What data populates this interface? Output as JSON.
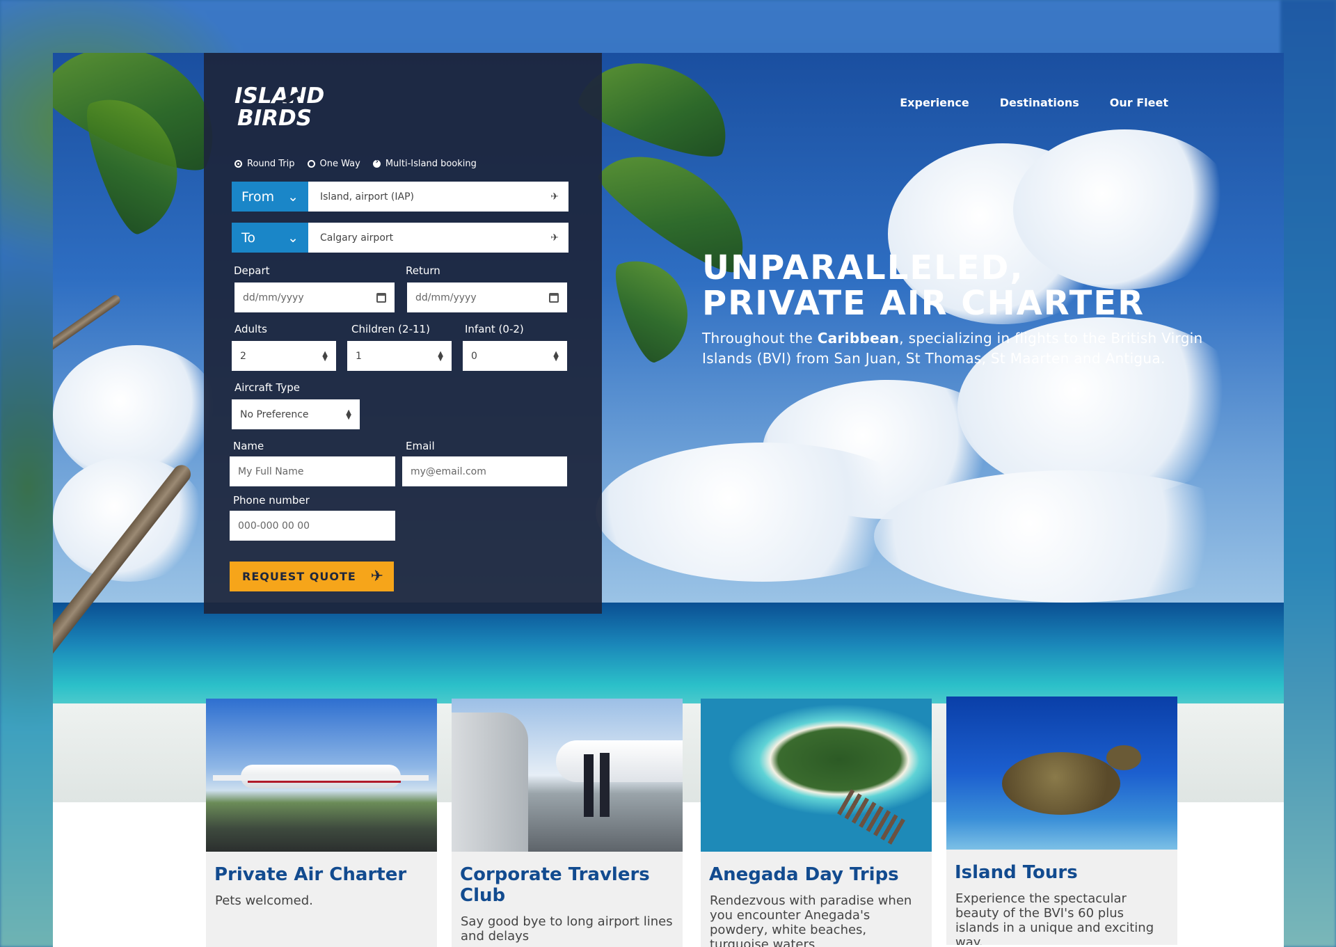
{
  "brand": {
    "logo_line1": "ISLAND",
    "logo_line2": "BIRDS"
  },
  "nav": {
    "items": [
      "Experience",
      "Destinations",
      "Our Fleet"
    ]
  },
  "hero": {
    "title_line1": "UNPARALLELED,",
    "title_line2": "PRIVATE AIR CHARTER",
    "subtitle_pre": "Throughout the ",
    "subtitle_bold": "Caribbean",
    "subtitle_post": ", specializing in flights to the British Virgin Islands (BVI) from San Juan, St Thomas, St Maarten and Antigua."
  },
  "booking": {
    "trip_types": [
      "Round Trip",
      "One Way",
      "Multi-Island booking"
    ],
    "from": {
      "label": "From",
      "value": "Island, airport (IAP)"
    },
    "to": {
      "label": "To",
      "value": "Calgary airport"
    },
    "depart": {
      "label": "Depart",
      "placeholder": "dd/mm/yyyy"
    },
    "return": {
      "label": "Return",
      "placeholder": "dd/mm/yyyy"
    },
    "adults": {
      "label": "Adults",
      "value": "2"
    },
    "children": {
      "label": "Children (2-11)",
      "value": "1"
    },
    "infant": {
      "label": "Infant (0-2)",
      "value": "0"
    },
    "aircraft": {
      "label": "Aircraft Type",
      "value": "No Preference"
    },
    "name": {
      "label": "Name",
      "placeholder": "My Full Name"
    },
    "email": {
      "label": "Email",
      "placeholder": "my@email.com"
    },
    "phone": {
      "label": "Phone number",
      "placeholder": "000-000 00 00"
    },
    "submit_label": "REQUEST QUOTE"
  },
  "cards": [
    {
      "title": "Private Air Charter",
      "text": "Pets welcomed."
    },
    {
      "title": "Corporate Travlers Club",
      "text": "Say good bye to long airport lines and delays"
    },
    {
      "title": "Anegada Day Trips",
      "text": "Rendezvous with paradise when you encounter Anegada's powdery, white beaches, turquoise waters"
    },
    {
      "title": "Island Tours",
      "text": "Experience the spectacular beauty of the BVI's 60 plus islands in a unique and exciting way."
    }
  ],
  "colors": {
    "panel": "#1d263c",
    "accent_blue": "#1a86c8",
    "button": "#f6a51a",
    "card_title": "#124b8f"
  }
}
